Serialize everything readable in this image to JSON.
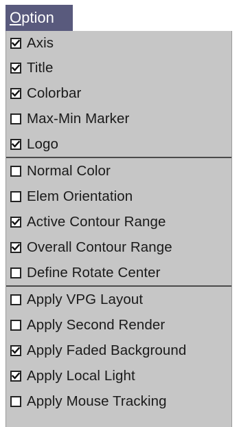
{
  "menu": {
    "title_mnemonic": "O",
    "title_rest": "ption"
  },
  "groups": [
    {
      "items": [
        {
          "label": "Axis",
          "checked": true
        },
        {
          "label": "Title",
          "checked": true
        },
        {
          "label": "Colorbar",
          "checked": true
        },
        {
          "label": "Max-Min Marker",
          "checked": false
        },
        {
          "label": "Logo",
          "checked": true
        }
      ]
    },
    {
      "items": [
        {
          "label": "Normal Color",
          "checked": false
        },
        {
          "label": "Elem Orientation",
          "checked": false
        },
        {
          "label": "Active Contour Range",
          "checked": true
        },
        {
          "label": "Overall Contour Range",
          "checked": true
        },
        {
          "label": "Define Rotate Center",
          "checked": false
        }
      ]
    },
    {
      "items": [
        {
          "label": "Apply VPG Layout",
          "checked": false
        },
        {
          "label": "Apply Second Render",
          "checked": false
        },
        {
          "label": "Apply Faded Background",
          "checked": true
        },
        {
          "label": "Apply Local Light",
          "checked": true
        },
        {
          "label": "Apply Mouse Tracking",
          "checked": false
        }
      ]
    }
  ]
}
